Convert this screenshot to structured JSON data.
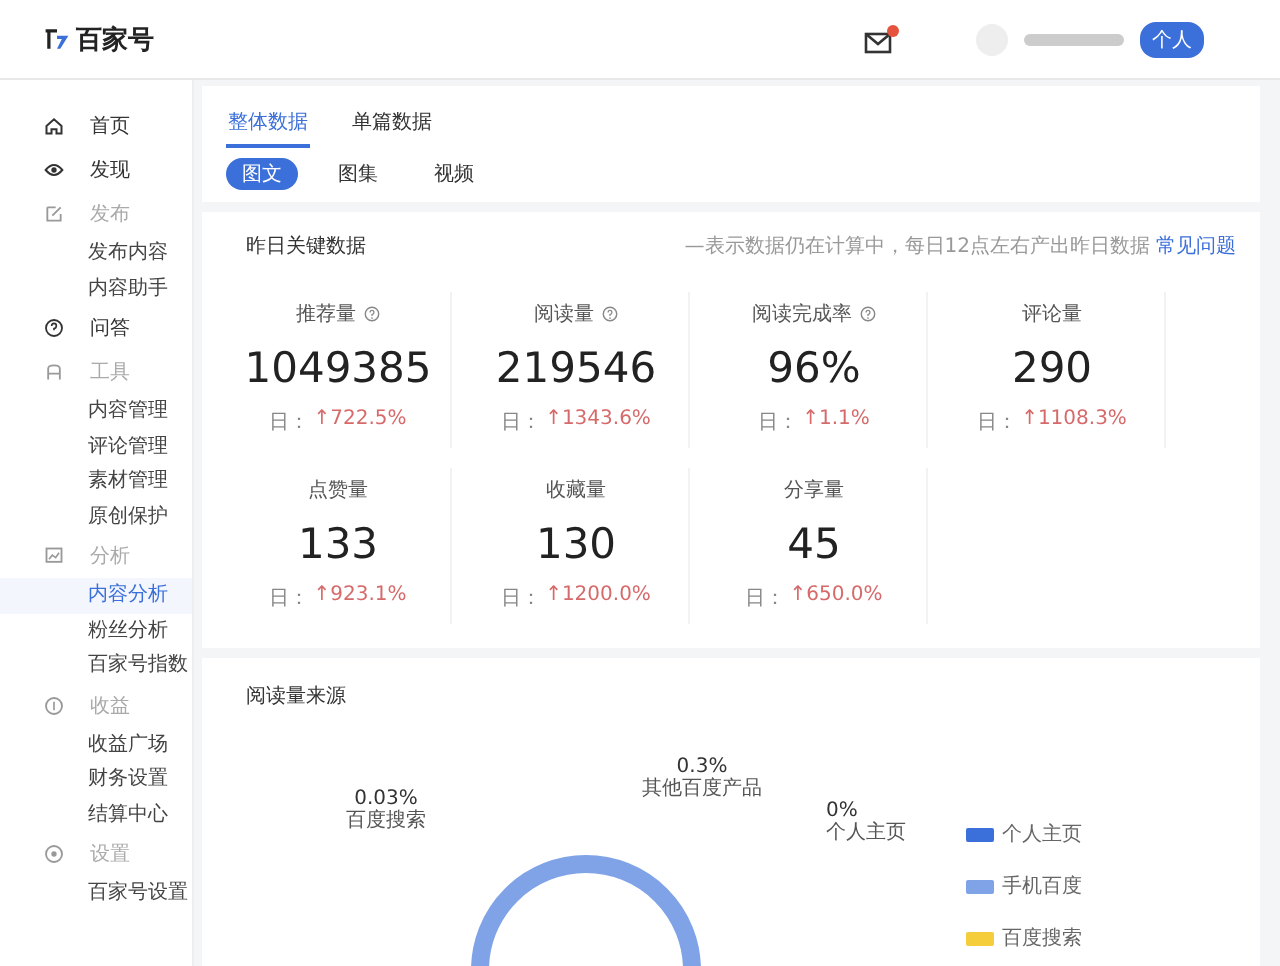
{
  "header": {
    "brand": "百家号",
    "account_badge": "个人"
  },
  "sidebar": {
    "items": [
      {
        "label": "首页",
        "selected": false
      },
      {
        "label": "发现",
        "selected": false
      },
      {
        "label": "发布",
        "selected": false,
        "children": [
          {
            "label": "发布内容",
            "selected": false
          },
          {
            "label": "内容助手",
            "selected": false
          }
        ]
      },
      {
        "label": "问答",
        "selected": false
      },
      {
        "label": "工具",
        "selected": false,
        "children": [
          {
            "label": "内容管理",
            "selected": false
          },
          {
            "label": "评论管理",
            "selected": false
          },
          {
            "label": "素材管理",
            "selected": false
          },
          {
            "label": "原创保护",
            "selected": false
          }
        ]
      },
      {
        "label": "分析",
        "selected": false,
        "children": [
          {
            "label": "内容分析",
            "selected": true
          },
          {
            "label": "粉丝分析",
            "selected": false
          },
          {
            "label": "百家号指数",
            "selected": false
          }
        ]
      },
      {
        "label": "收益",
        "selected": false,
        "children": [
          {
            "label": "收益广场",
            "selected": false
          },
          {
            "label": "财务设置",
            "selected": false
          },
          {
            "label": "结算中心",
            "selected": false
          }
        ]
      },
      {
        "label": "设置",
        "selected": false,
        "children": [
          {
            "label": "百家号设置",
            "selected": false
          }
        ]
      }
    ]
  },
  "tabs": [
    {
      "label": "整体数据",
      "selected": true
    },
    {
      "label": "单篇数据",
      "selected": false
    }
  ],
  "sub_tabs": [
    {
      "label": "图文",
      "selected": true
    },
    {
      "label": "图集",
      "selected": false
    },
    {
      "label": "视频",
      "selected": false
    }
  ],
  "key_data": {
    "title": "昨日关键数据",
    "note": "—表示数据仍在计算中，每日12点左右产出昨日数据",
    "link": "常见问题",
    "metrics": [
      {
        "label": "推荐量",
        "help": true,
        "value": "1049385",
        "day_label": "日：",
        "change": "↑722.5%"
      },
      {
        "label": "阅读量",
        "help": true,
        "value": "219546",
        "day_label": "日：",
        "change": "↑1343.6%"
      },
      {
        "label": "阅读完成率",
        "help": true,
        "value": "96%",
        "day_label": "日：",
        "change": "↑1.1%"
      },
      {
        "label": "评论量",
        "help": false,
        "value": "290",
        "day_label": "日：",
        "change": "↑1108.3%"
      },
      {
        "label": "点赞量",
        "help": false,
        "value": "133",
        "day_label": "日：",
        "change": "↑923.1%"
      },
      {
        "label": "收藏量",
        "help": false,
        "value": "130",
        "day_label": "日：",
        "change": "↑1200.0%"
      },
      {
        "label": "分享量",
        "help": false,
        "value": "45",
        "day_label": "日：",
        "change": "↑650.0%"
      }
    ]
  },
  "read_source": {
    "title": "阅读量来源",
    "slice_labels": [
      {
        "percent": "0.3%",
        "name": "其他百度产品"
      },
      {
        "percent": "0.03%",
        "name": "百度搜索"
      },
      {
        "percent": "0%",
        "name": "个人主页"
      }
    ],
    "legend": [
      {
        "label": "个人主页",
        "color": "#3b6fd9"
      },
      {
        "label": "手机百度",
        "color": "#7fa3e6"
      },
      {
        "label": "百度搜索",
        "color": "#f5cc3a"
      }
    ]
  }
}
